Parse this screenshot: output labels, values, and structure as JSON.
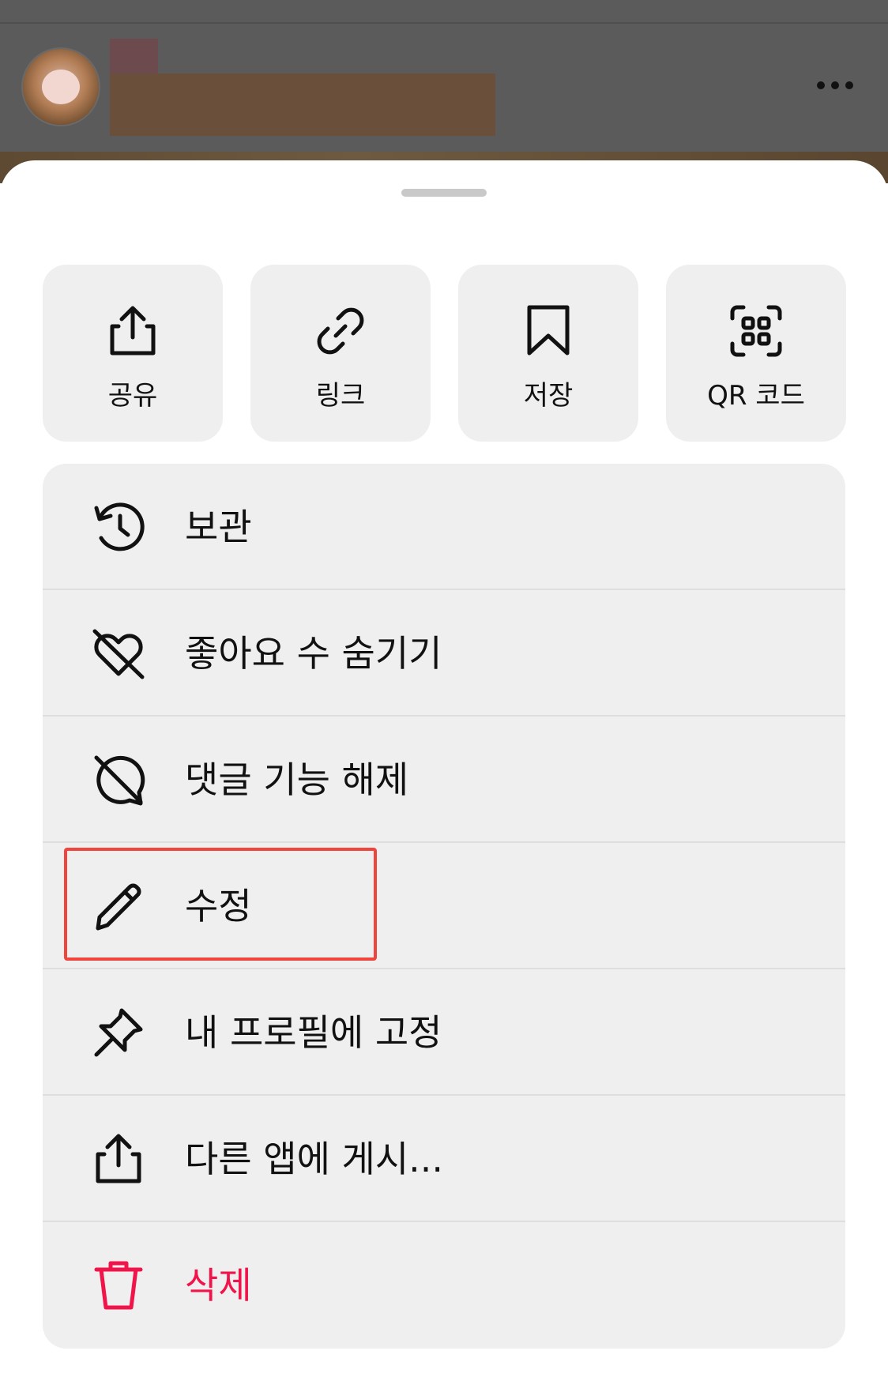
{
  "background": {
    "more_icon": "more-horizontal-icon"
  },
  "actions": [
    {
      "label": "공유",
      "icon": "share-icon"
    },
    {
      "label": "링크",
      "icon": "link-icon"
    },
    {
      "label": "저장",
      "icon": "bookmark-icon"
    },
    {
      "label": "QR 코드",
      "icon": "qr-code-icon"
    }
  ],
  "menu": [
    {
      "label": "보관",
      "icon": "archive-history-icon"
    },
    {
      "label": "좋아요 수 숨기기",
      "icon": "heart-off-icon"
    },
    {
      "label": "댓글 기능 해제",
      "icon": "comment-off-icon"
    },
    {
      "label": "수정",
      "icon": "pencil-icon"
    },
    {
      "label": "내 프로필에 고정",
      "icon": "pin-icon"
    },
    {
      "label": "다른 앱에 게시...",
      "icon": "share-out-icon"
    },
    {
      "label": "삭제",
      "icon": "trash-icon"
    }
  ],
  "colors": {
    "danger": "#f0144a",
    "highlight": "#f0453c",
    "tile_bg": "#efefef"
  }
}
